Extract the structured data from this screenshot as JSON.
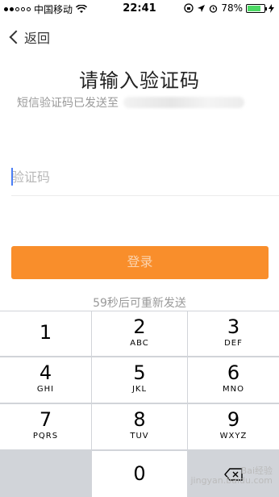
{
  "status_bar": {
    "carrier": "中国移动",
    "time": "22:41",
    "battery_percent": "78%",
    "battery_level": 0.78
  },
  "nav": {
    "back_label": "返回"
  },
  "page": {
    "title": "请输入验证码",
    "subtitle_prefix": "短信验证码已发送至"
  },
  "code_input": {
    "placeholder": "验证码",
    "value": ""
  },
  "login_button": {
    "label": "登录"
  },
  "resend": {
    "text": "59秒后可重新发送"
  },
  "keypad": {
    "keys": [
      {
        "num": "1",
        "letters": ""
      },
      {
        "num": "2",
        "letters": "ABC"
      },
      {
        "num": "3",
        "letters": "DEF"
      },
      {
        "num": "4",
        "letters": "GHI"
      },
      {
        "num": "5",
        "letters": "JKL"
      },
      {
        "num": "6",
        "letters": "MNO"
      },
      {
        "num": "7",
        "letters": "PQRS"
      },
      {
        "num": "8",
        "letters": "TUV"
      },
      {
        "num": "9",
        "letters": "WXYZ"
      },
      {
        "num": "0",
        "letters": ""
      }
    ]
  },
  "colors": {
    "accent": "#f98e2b",
    "keypad_bg": "#d1d4d9",
    "battery": "#4cd964"
  },
  "watermark": {
    "line1": "Bai经验",
    "line2": "jingyan.baidu.com"
  }
}
